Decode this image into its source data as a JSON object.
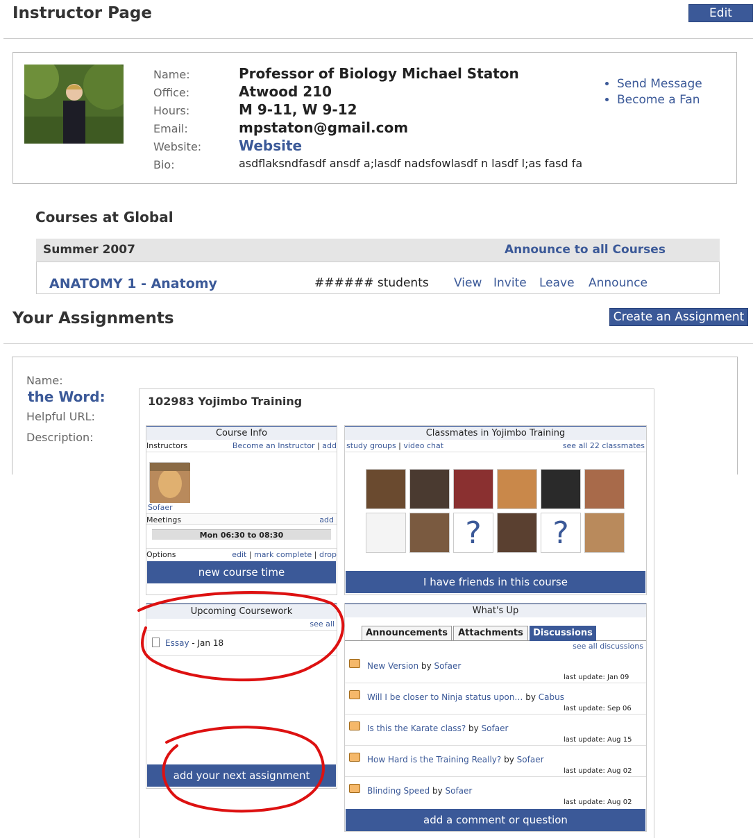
{
  "instructor": {
    "title": "Instructor Page",
    "edit_label": "Edit",
    "labels": [
      "Name:",
      "Office:",
      "Hours:",
      "Email:",
      "Website:",
      "Bio:"
    ],
    "name": "Professor of Biology Michael Staton",
    "office": "Atwood 210",
    "hours": "M 9-11, W 9-12",
    "email": "mpstaton@gmail.com",
    "website": "Website",
    "bio": "asdflaksndfasdf ansdf a;lasdf nadsfowlasdf n lasdf l;as fasd fa",
    "actions": [
      "Send Message",
      "Become a Fan"
    ]
  },
  "courses": {
    "heading": "Courses at Global",
    "term": "Summer 2007",
    "announce_all": "Announce to all Courses",
    "course_name": "ANATOMY 1 - Anatomy",
    "students": "###### students",
    "links": [
      "View",
      "Invite",
      "Leave",
      "Announce"
    ]
  },
  "assignments": {
    "title": "Your Assignments",
    "create_label": "Create an Assignment",
    "labels": [
      "Name:",
      "Helpful URL:",
      "Description:"
    ],
    "name_value": "the Word:"
  },
  "course_page": {
    "title": "102983 Yojimbo Training",
    "course_info": {
      "heading": "Course Info",
      "instructors_label": "Instructors",
      "become_instructor": "Become an Instructor",
      "add": "add",
      "instructor_name": "Sofaer",
      "meetings_label": "Meetings",
      "meetings_add": "add",
      "meeting_time": "Mon 06:30 to 08:30",
      "options_label": "Options",
      "edit": "edit",
      "mark_complete": "mark complete",
      "drop": "drop",
      "new_course_time": "new course time"
    },
    "classmates": {
      "heading": "Classmates in Yojimbo Training",
      "study_groups": "study groups",
      "video_chat": "video chat",
      "see_all": "see all 22 classmates",
      "friends_button": "I have friends in this course"
    },
    "coursework": {
      "heading": "Upcoming Coursework",
      "see_all": "see all",
      "item_name": "Essay",
      "item_date": " - Jan 18",
      "add_button": "add your next assignment"
    },
    "whats_up": {
      "heading": "What's Up",
      "tabs": [
        "Announcements",
        "Attachments",
        "Discussions"
      ],
      "see_all": "see all discussions",
      "threads": [
        {
          "title": "New Version",
          "by": "by",
          "author": "Sofaer",
          "update": "last update: Jan 09"
        },
        {
          "title": "Will I be closer to Ninja status upon…",
          "by": "by",
          "author": "Cabus",
          "update": "last update: Sep 06"
        },
        {
          "title": "Is this the Karate class?",
          "by": "by",
          "author": "Sofaer",
          "update": "last update: Aug 15"
        },
        {
          "title": "How Hard is the Training Really?",
          "by": "by",
          "author": "Sofaer",
          "update": "last update: Aug 02"
        },
        {
          "title": "Blinding Speed",
          "by": "by",
          "author": "Sofaer",
          "update": "last update: Aug 02"
        }
      ],
      "add_comment": "add a comment or question"
    }
  },
  "colors": {
    "brand": "#3b5998",
    "annotation": "#dd1111"
  }
}
